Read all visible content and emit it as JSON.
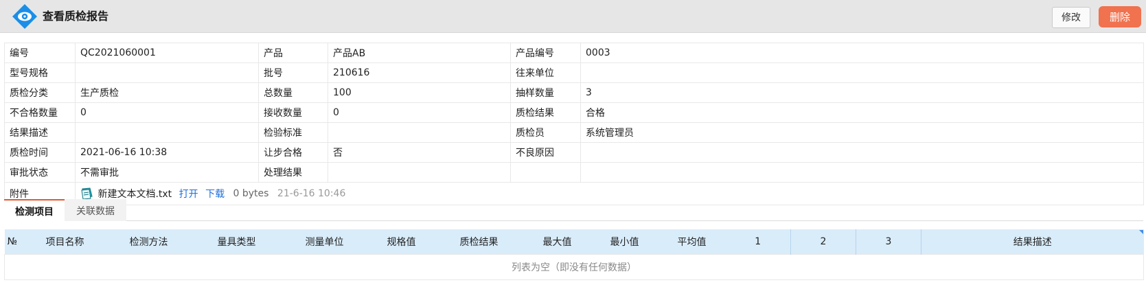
{
  "header": {
    "title": "查看质检报告",
    "edit_label": "修改",
    "delete_label": "删除",
    "logo_icon": "eye-diamond-icon",
    "logo_color": "#1a8ee8"
  },
  "fields": {
    "code_label": "编号",
    "code_value": "QC2021060001",
    "product_label": "产品",
    "product_value": "产品AB",
    "product_no_label": "产品编号",
    "product_no_value": "0003",
    "model_label": "型号规格",
    "model_value": "",
    "batch_label": "批号",
    "batch_value": "210616",
    "partner_label": "往来单位",
    "partner_value": "",
    "category_label": "质检分类",
    "category_value": "生产质检",
    "total_label": "总数量",
    "total_value": "100",
    "sample_label": "抽样数量",
    "sample_value": "3",
    "unqualified_label": "不合格数量",
    "unqualified_value": "0",
    "received_label": "接收数量",
    "received_value": "0",
    "result_label": "质检结果",
    "result_value": "合格",
    "result_desc_label": "结果描述",
    "result_desc_value": "",
    "standard_label": "检验标准",
    "standard_value": "",
    "inspector_label": "质检员",
    "inspector_value": "系统管理员",
    "time_label": "质检时间",
    "time_value": "2021-06-16 10:38",
    "concession_label": "让步合格",
    "concession_value": "否",
    "defect_label": "不良原因",
    "defect_value": "",
    "approval_label": "审批状态",
    "approval_value": "不需审批",
    "handling_label": "处理结果",
    "handling_value": ""
  },
  "attachment": {
    "label": "附件",
    "filename": "新建文本文档.txt",
    "open_label": "打开",
    "download_label": "下载",
    "size": "0 bytes",
    "date": "21-6-16 10:46",
    "icon": "text-file-icon"
  },
  "tabs": [
    {
      "label": "检测项目",
      "active": true
    },
    {
      "label": "关联数据",
      "active": false
    }
  ],
  "grid": {
    "columns": [
      "№",
      "项目名称",
      "检测方法",
      "量具类型",
      "测量单位",
      "规格值",
      "质检结果",
      "最大值",
      "最小值",
      "平均值",
      "1",
      "2",
      "3",
      "结果描述"
    ],
    "empty_text": "列表为空（即没有任何数据）",
    "header_color": "#d9ecfa"
  },
  "colors": {
    "accent_tab": "#e4572e",
    "delete_button": "#f0724e",
    "link": "#1e6fd9"
  }
}
